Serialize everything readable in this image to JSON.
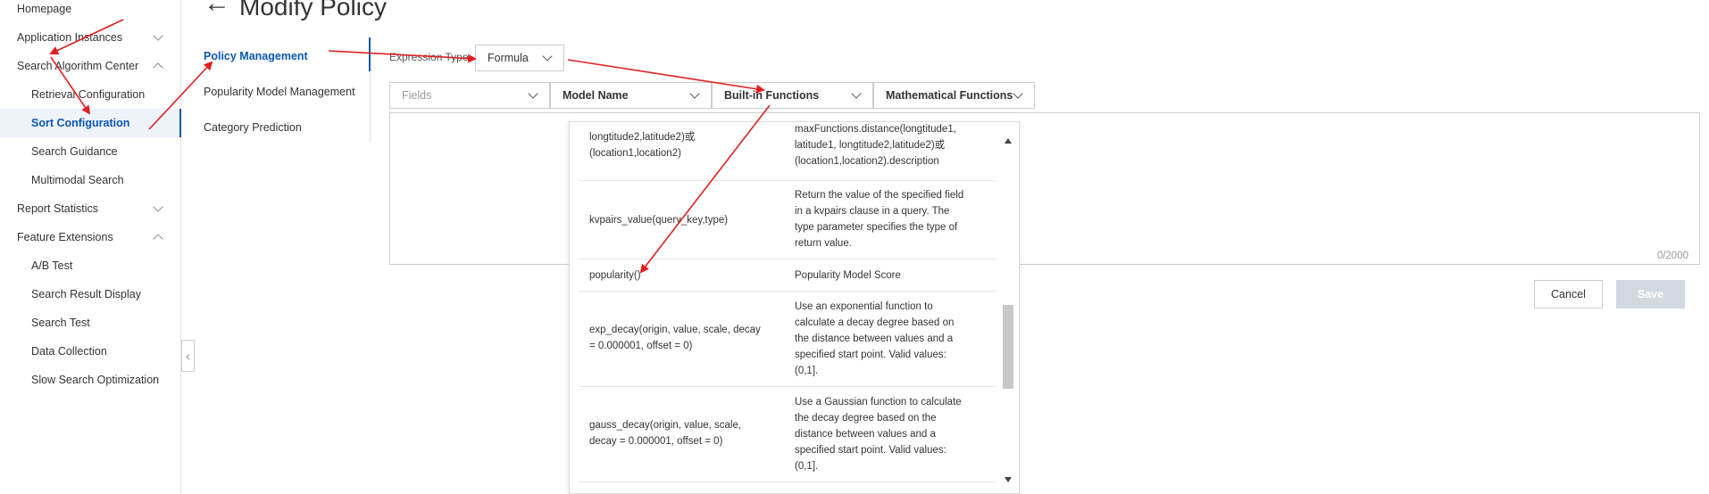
{
  "sidebar": {
    "items": [
      {
        "label": "Homepage",
        "type": "child",
        "top": 0
      },
      {
        "label": "Application Instances",
        "type": "group",
        "chevron": "down"
      },
      {
        "label": "Search Algorithm Center",
        "type": "group",
        "chevron": "up"
      },
      {
        "label": "Retrieval Configuration",
        "type": "child"
      },
      {
        "label": "Sort Configuration",
        "type": "child",
        "active": true
      },
      {
        "label": "Search Guidance",
        "type": "child"
      },
      {
        "label": "Multimodal Search",
        "type": "child"
      },
      {
        "label": "Report Statistics",
        "type": "group",
        "chevron": "down"
      },
      {
        "label": "Feature Extensions",
        "type": "group",
        "chevron": "up"
      },
      {
        "label": "A/B Test",
        "type": "child"
      },
      {
        "label": "Search Result Display",
        "type": "child"
      },
      {
        "label": "Search Test",
        "type": "child"
      },
      {
        "label": "Data Collection",
        "type": "child"
      },
      {
        "label": "Slow Search Optimization",
        "type": "child"
      }
    ]
  },
  "header": {
    "title": "Modify Policy"
  },
  "subnav": {
    "items": [
      {
        "label": "Policy Management",
        "active": true
      },
      {
        "label": "Popularity Model Management"
      },
      {
        "label": "Category Prediction"
      }
    ]
  },
  "expression": {
    "label": "Expression Type",
    "value": "Formula"
  },
  "filters": {
    "fields": "Fields",
    "model_name": "Model Name",
    "builtin": "Built-in Functions",
    "math": "Mathematical Functions"
  },
  "editor": {
    "counter": "0/2000"
  },
  "buttons": {
    "cancel": "Cancel",
    "save": "Save"
  },
  "functions": [
    {
      "name": "longtitude2,latitude2)或\n(location1,location2)",
      "desc": "maxFunctions.distance(longtitude1,\nlatitude1, longtitude2,latitude2)或\n(location1,location2).description"
    },
    {
      "name": "kvpairs_value(query_key,type)",
      "desc": "Return the value of the specified field\nin a kvpairs clause in a query. The\ntype parameter specifies the type of\nreturn value."
    },
    {
      "name": "popularity()",
      "desc": "Popularity Model Score"
    },
    {
      "name": "exp_decay(origin, value, scale, decay\n= 0.000001, offset = 0)",
      "desc": "Use an exponential function to\ncalculate a decay degree based on\nthe distance between values and a\nspecified start point. Valid values:\n(0,1]."
    },
    {
      "name": "gauss_decay(origin, value, scale,\ndecay = 0.000001, offset = 0)",
      "desc": "Use a Gaussian function to calculate\nthe decay degree based on the\ndistance between values and a\nspecified start point. Valid values:\n(0,1]."
    }
  ]
}
